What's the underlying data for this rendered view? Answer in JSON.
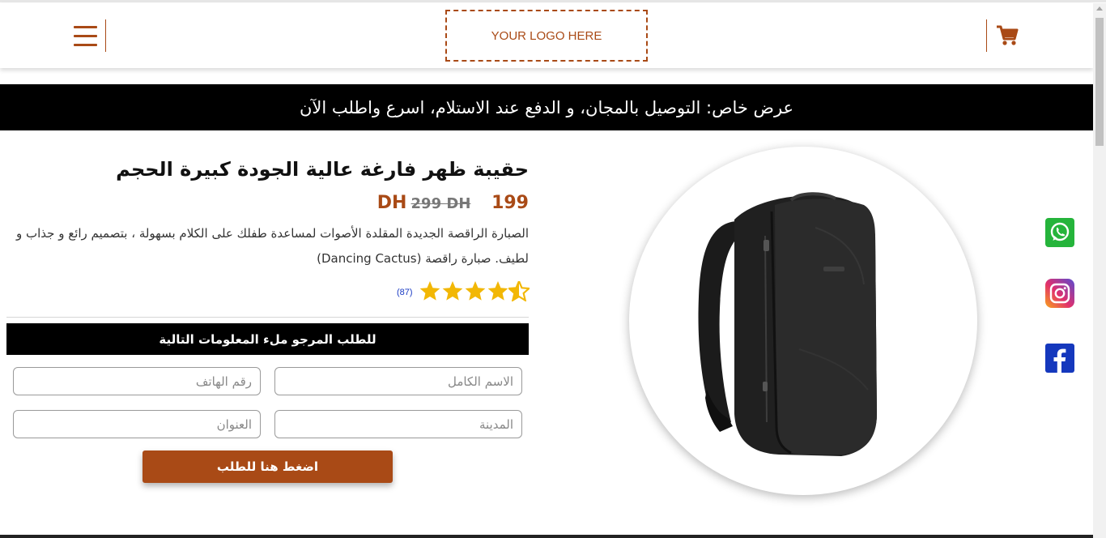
{
  "header": {
    "logo_text": "YOUR LOGO HERE",
    "menu_icon": "hamburger-menu-icon",
    "cart_icon": "shopping-cart-icon"
  },
  "banner": {
    "text": "عرض خاص: التوصيل بالمجان، و الدفع عند الاستلام، اسرع واطلب الآن"
  },
  "product": {
    "title": "حقيبة ظهر فارغة عالية الجودة كبيرة الحجم",
    "price_new": "199 DH",
    "price_old": "299 DH",
    "description": "الصبارة الراقصة الجديدة المقلدة الأصوات لمساعدة طفلك على الكلام بسهولة ، بتصميم رائع و جذاب و لطيف. صبارة راقصة (Dancing Cactus)",
    "rating": {
      "stars": 4.5,
      "max": 5,
      "count": "(87)"
    },
    "image_icon": "backpack-product-image"
  },
  "form": {
    "heading": "للطلب المرجو ملء المعلومات التالية",
    "fullname_placeholder": "الاسم الكامل",
    "phone_placeholder": "رقم الهاتف",
    "city_placeholder": "المدينة",
    "address_placeholder": "العنوان",
    "submit_label": "اضغط هنا للطلب"
  },
  "social": [
    "whatsapp-icon",
    "instagram-icon",
    "facebook-icon"
  ],
  "colors": {
    "brand": "#a94a16",
    "banner_bg": "#000000",
    "star": "#f2b705",
    "whatsapp": "#25b43b",
    "facebook": "#1538bd"
  }
}
